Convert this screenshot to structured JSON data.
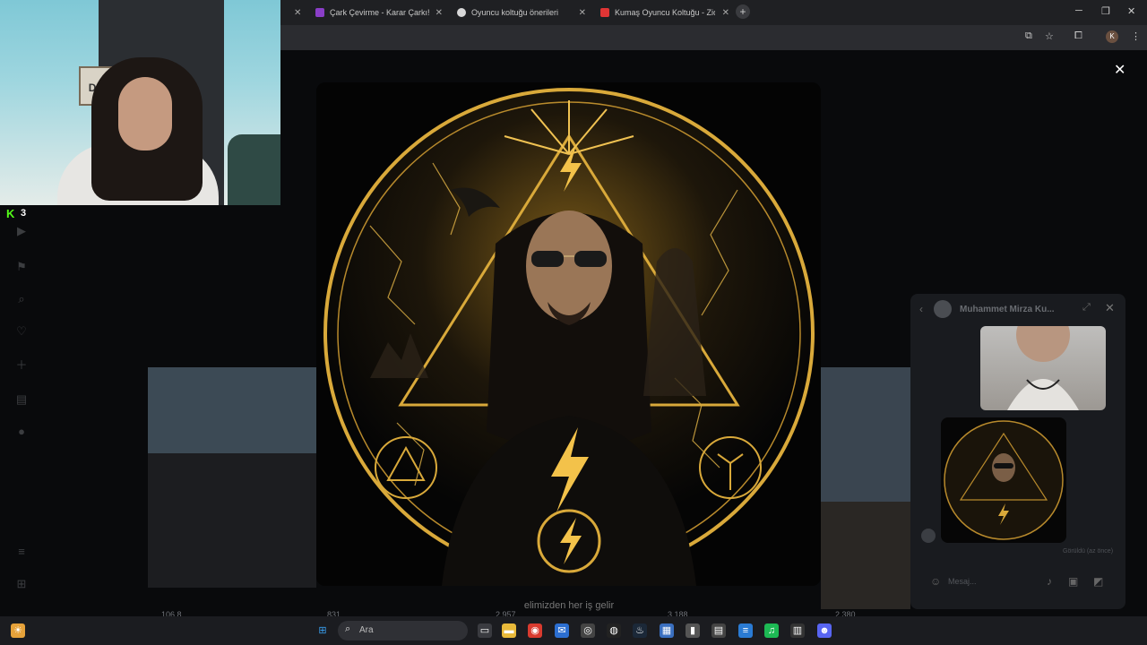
{
  "browser": {
    "tabs": [
      {
        "label": "Çark Çevirme - Karar Çarkı!",
        "favicon_color": "#8a3ec7"
      },
      {
        "label": "Oyuncu koltuğu önerileri",
        "favicon_color": "#d8d8d8"
      },
      {
        "label": "Kumaş Oyuncu Koltuğu - Zio G",
        "favicon_color": "#e03535"
      }
    ],
    "new_tab": "+",
    "profile_initial": "K"
  },
  "overlay": {
    "platform_logo": "K",
    "viewer_count": "3"
  },
  "lightbox": {
    "caption": "elimizden her iş gelir",
    "thumb_counts": [
      "106.8",
      "831",
      "2.957",
      "3.188",
      "2.380"
    ]
  },
  "chat": {
    "contact_name": "Muhammet Mirza Ku...",
    "seen_status": "Görüldü (az önce)",
    "input_placeholder": "Mesaj..."
  },
  "taskbar": {
    "search_placeholder": "Ara"
  },
  "colors": {
    "accent_gold": "#d9a93a",
    "kick_green": "#53fc18"
  }
}
